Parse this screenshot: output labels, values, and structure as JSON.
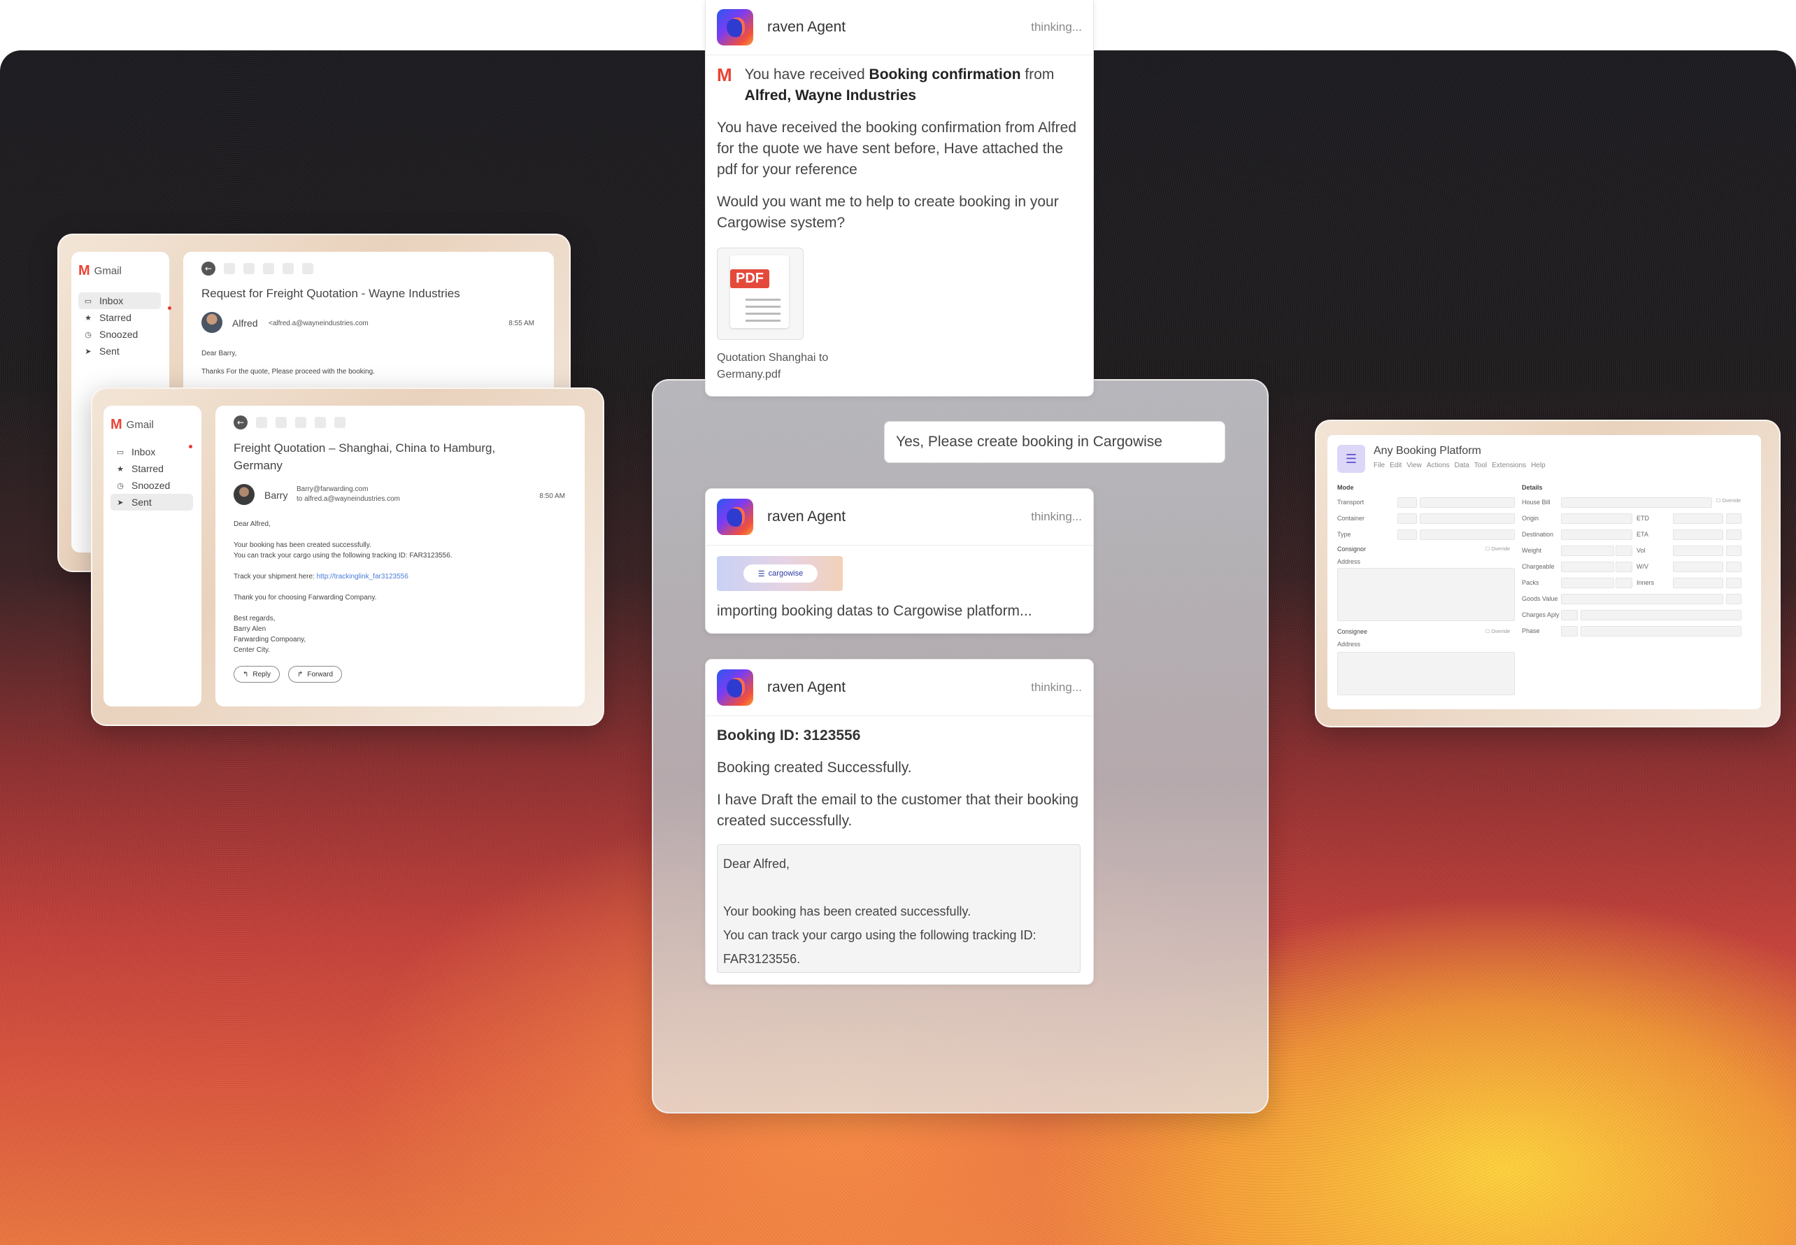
{
  "gmail_back": {
    "logo": "Gmail",
    "nav": [
      "Inbox",
      "Starred",
      "Snoozed",
      "Sent"
    ],
    "subject": "Request for Freight Quotation - Wayne Industries",
    "sender_name": "Alfred",
    "sender_email": "<alfred.a@wayneindustries.com",
    "time": "8:55 AM",
    "greeting": "Dear Barry,",
    "body": "Thanks For the quote, Please proceed with the booking."
  },
  "gmail_front": {
    "logo": "Gmail",
    "nav": [
      "Inbox",
      "Starred",
      "Snoozed",
      "Sent"
    ],
    "subject": "Freight Quotation – Shanghai, China to Hamburg, Germany",
    "sender_name": "Barry",
    "sender_email": "Barry@farwarding.com",
    "to": "to alfred.a@wayneindustries.com",
    "time": "8:50 AM",
    "greeting": "Dear Alfred,",
    "line1": "Your booking has been created successfully.",
    "line2": "You can track your cargo using the following tracking ID: FAR3123556.",
    "track_prefix": "Track your shipment here: ",
    "track_link": "http://trackinglink_far3123556",
    "thanks": "Thank you for choosing Farwarding Company.",
    "sig1": "Best regards,",
    "sig2": "Barry Alen",
    "sig3": "Farwarding Compoany,",
    "sig4": "Center City.",
    "reply": "Reply",
    "forward": "Forward"
  },
  "agent_top": {
    "name": "raven Agent",
    "status": "thinking...",
    "notice_prefix": "You have received ",
    "notice_bold": "Booking confirmation",
    "notice_mid": " from",
    "notice_from": "Alfred, Wayne Industries",
    "para1": "You have received the booking confirmation from Alfred for the quote we have sent before, Have attached the pdf for your reference",
    "para2": "Would you want me to help to create booking in your Cargowise system?",
    "pdf_badge": "PDF",
    "pdf_name_1": "Quotation Shanghai to",
    "pdf_name_2": "Germany.pdf"
  },
  "user_msg": "Yes, Please create booking in Cargowise",
  "agent_mid": {
    "name": "raven Agent",
    "status": "thinking...",
    "logo_text": "cargowise",
    "text": "importing booking datas to Cargowise platform..."
  },
  "agent_bottom": {
    "name": "raven Agent",
    "status": "thinking...",
    "booking_id": "Booking ID: 3123556",
    "created": "Booking created Successfully.",
    "draft_note": "I have Draft the email to the customer that their booking created successfully.",
    "draft_greeting": "Dear Alfred,",
    "draft_line1": "Your booking has been created successfully.",
    "draft_line2": "You can track your cargo using the following tracking ID: FAR3123556."
  },
  "platform": {
    "title": "Any Booking Platform",
    "menu": [
      "File",
      "Edit",
      "View",
      "Actions",
      "Data",
      "Tool",
      "Extensions",
      "Help"
    ],
    "mode_header": "Mode",
    "left_fields": [
      "Transport",
      "Container",
      "Type"
    ],
    "consignor": "Consignor",
    "consignee": "Consignee",
    "address": "Address",
    "override": "Override",
    "details_header": "Details",
    "right_fields": [
      "House Bill",
      "Origin",
      "Destination",
      "Weight",
      "Chargeable",
      "Packs",
      "Goods Value",
      "Charges Aply",
      "Phase"
    ],
    "right_fields_2": [
      "ETD",
      "ETA",
      "Vol",
      "W/V",
      "Inners"
    ]
  }
}
